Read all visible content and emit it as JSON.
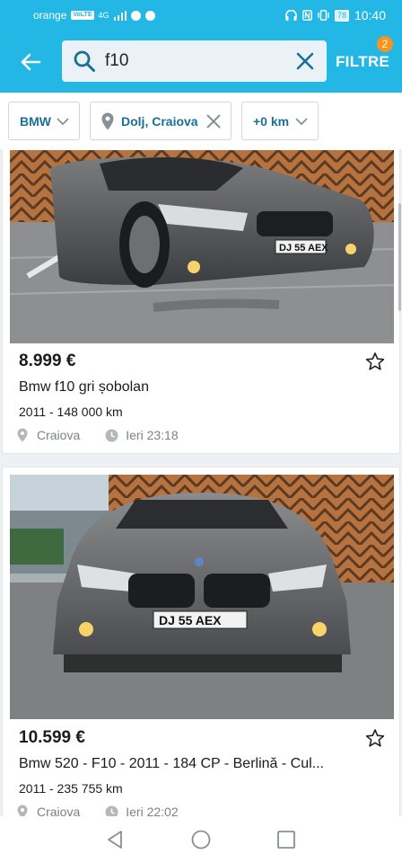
{
  "status_bar": {
    "carrier": "orange",
    "volte_badge": "VoLTE",
    "network": "4G",
    "battery": "78",
    "time": "10:40"
  },
  "search": {
    "back_icon": "arrow-left-icon",
    "query": "f10",
    "search_icon": "search-icon",
    "clear_icon": "close-icon",
    "filter_label": "FILTRE",
    "filter_count": "2"
  },
  "chips": {
    "brand": "BMW",
    "location": "Dolj, Craiova",
    "radius": "+0 km"
  },
  "listings": [
    {
      "price": "8.999 €",
      "title": "Bmw f10 gri șobolan",
      "year_km": "2011  - 148 000 km",
      "location": "Craiova",
      "time": "Ieri 23:18",
      "plate": "DJ 55 AEX"
    },
    {
      "price": "10.599 €",
      "title": "Bmw 520 - F10 - 2011 - 184 CP - Berlină - Cul...",
      "year_km": "2011  - 235 755 km",
      "location": "Craiova",
      "time": "Ieri 22:02",
      "plate": "DJ 55 AEX"
    }
  ],
  "colors": {
    "accent": "#23b7e5",
    "chip_text": "#1a6f96",
    "badge": "#f7931e"
  }
}
